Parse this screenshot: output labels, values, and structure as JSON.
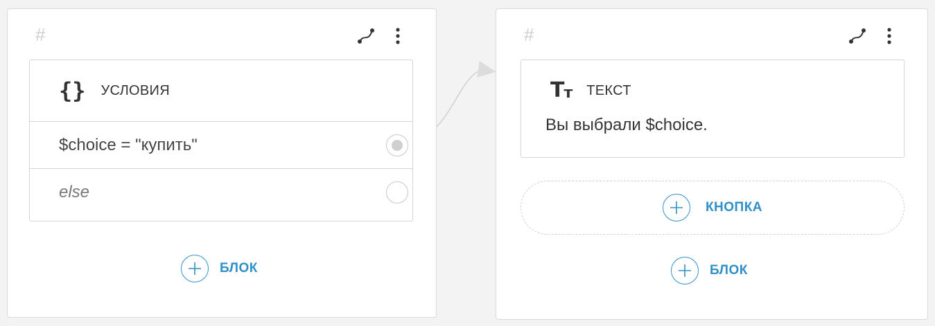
{
  "left_card": {
    "hash": "#",
    "block": {
      "title": "условия",
      "icon": "braces-icon",
      "conditions": [
        {
          "text": "$choice = \"купить\"",
          "selected": true
        },
        {
          "text": "else",
          "selected": false
        }
      ]
    },
    "add_block_label": "блок"
  },
  "right_card": {
    "hash": "#",
    "block": {
      "title": "текст",
      "icon": "text-format-icon",
      "content": "Вы выбрали $choice."
    },
    "add_button_label": "кнопка",
    "add_block_label": "блок"
  },
  "icons": {
    "route": "route-icon",
    "more": "more-vertical-icon",
    "plus": "plus-circle-icon",
    "arrow": "connector-arrow"
  },
  "colors": {
    "accent": "#2f8fc9",
    "background": "#f3f3f3",
    "card": "#ffffff",
    "border": "#d9d9d9"
  }
}
